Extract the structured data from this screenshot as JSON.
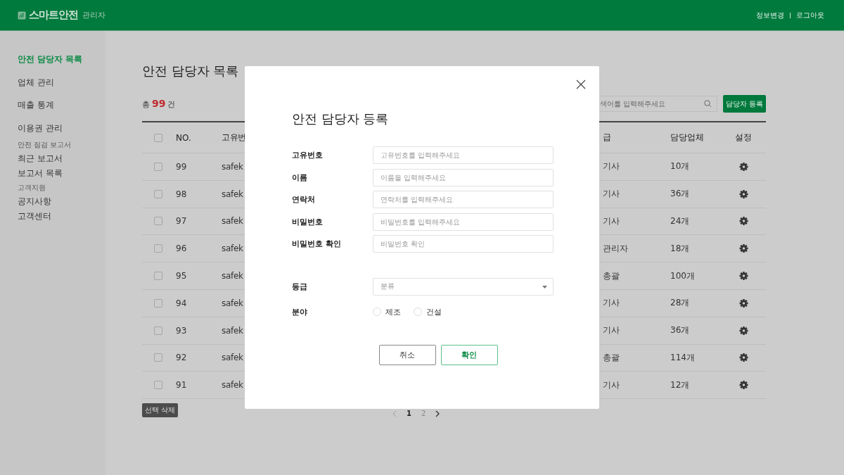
{
  "header": {
    "logo": "스마트안전",
    "logo_sub": "관리자",
    "links": [
      "정보변경",
      "로그아웃"
    ]
  },
  "sidebar": {
    "items": [
      {
        "label": "안전 담당자 목록",
        "selected": true
      },
      {
        "label": "업체 관리",
        "selected": false
      },
      {
        "label": "매출 통계",
        "selected": false
      },
      {
        "label": "이용권 관리",
        "selected": false
      }
    ],
    "groups": [
      {
        "title": "안전 점검 보고서",
        "items": [
          {
            "label": "최근 보고서",
            "selected": false
          },
          {
            "label": "보고서 목록",
            "selected": false
          }
        ]
      },
      {
        "title": "고객지원",
        "items": [
          {
            "label": "공지사항",
            "selected": false
          },
          {
            "label": "고객센터",
            "selected": false
          }
        ]
      }
    ]
  },
  "page": {
    "title": "안전 담당자 목록",
    "total": {
      "prefix": "총",
      "count": "99",
      "suffix": "건"
    },
    "search": {
      "placeholder": "색어를 입력해주세요"
    },
    "register_button": "담당자 등록",
    "table": {
      "select_all_checked": false,
      "columns": [
        "NO.",
        "고유번",
        "급",
        "담당업체",
        "설정"
      ],
      "rows": [
        {
          "checked": false,
          "no": "99",
          "id": "safek",
          "grade": "기사",
          "companies": "10개"
        },
        {
          "checked": false,
          "no": "98",
          "id": "safek",
          "grade": "기사",
          "companies": "36개"
        },
        {
          "checked": false,
          "no": "97",
          "id": "safek",
          "grade": "기사",
          "companies": "24개"
        },
        {
          "checked": false,
          "no": "96",
          "id": "safek",
          "grade": "관리자",
          "companies": "18개"
        },
        {
          "checked": false,
          "no": "95",
          "id": "safek",
          "grade": "총괄",
          "companies": "100개"
        },
        {
          "checked": false,
          "no": "94",
          "id": "safek",
          "grade": "기사",
          "companies": "28개"
        },
        {
          "checked": false,
          "no": "93",
          "id": "safek",
          "grade": "기사",
          "companies": "36개"
        },
        {
          "checked": false,
          "no": "92",
          "id": "safek",
          "grade": "총괄",
          "companies": "114개"
        },
        {
          "checked": false,
          "no": "91",
          "id": "safek",
          "grade": "기사",
          "companies": "12개"
        }
      ]
    },
    "delete_button": "선택 삭제",
    "pagination": {
      "pages": [
        {
          "label": "1",
          "selected": true
        },
        {
          "label": "2",
          "selected": false
        }
      ]
    }
  },
  "modal": {
    "title": "안전 담당자 등록",
    "fields": [
      {
        "label": "고유번호",
        "placeholder": "고유번호를 입력해주세요"
      },
      {
        "label": "이름",
        "placeholder": "이름을 입력해주세요"
      },
      {
        "label": "연락처",
        "placeholder": "연락처를 입력해주세요"
      },
      {
        "label": "비밀번호",
        "placeholder": "비밀번호를 입력해주세요"
      },
      {
        "label": "비밀번호 확인",
        "placeholder": "비밀번호 확인"
      }
    ],
    "select": {
      "label": "등급",
      "placeholder": "분류"
    },
    "radio": {
      "label": "분야",
      "options": [
        {
          "label": "제조",
          "selected": false
        },
        {
          "label": "건설",
          "selected": false
        }
      ]
    },
    "cancel_button": "취소",
    "confirm_button": "확인"
  }
}
